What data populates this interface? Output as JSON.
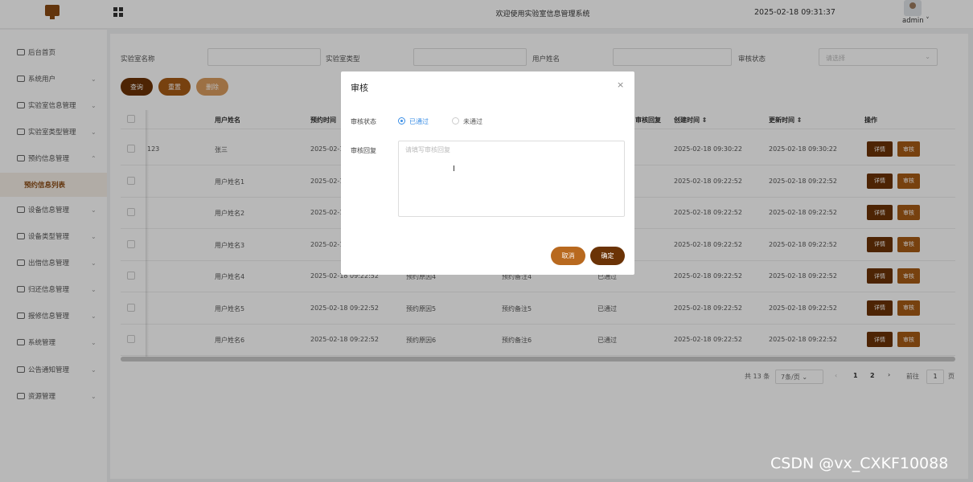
{
  "header": {
    "title": "欢迎使用实验室信息管理系统",
    "clock": "2025-02-18 09:31:37",
    "user": "admin ˅"
  },
  "sidebar": {
    "items": [
      {
        "label": "后台首页",
        "arrow": "",
        "icon": "clock-icon"
      },
      {
        "label": "系统用户",
        "arrow": "⌄",
        "icon": "user-icon"
      },
      {
        "label": "实验室信息管理",
        "arrow": "⌄",
        "icon": "list-icon"
      },
      {
        "label": "实验室类型管理",
        "arrow": "⌄",
        "icon": "list-icon"
      },
      {
        "label": "预约信息管理",
        "arrow": "⌃",
        "icon": "list-icon"
      },
      {
        "label": "预约信息列表",
        "arrow": "",
        "icon": ""
      },
      {
        "label": "设备信息管理",
        "arrow": "⌄",
        "icon": "list-icon"
      },
      {
        "label": "设备类型管理",
        "arrow": "⌄",
        "icon": "list-icon"
      },
      {
        "label": "出借信息管理",
        "arrow": "⌄",
        "icon": "list-icon"
      },
      {
        "label": "归还信息管理",
        "arrow": "⌄",
        "icon": "list-icon"
      },
      {
        "label": "报修信息管理",
        "arrow": "⌄",
        "icon": "list-icon"
      },
      {
        "label": "系统管理",
        "arrow": "⌄",
        "icon": "folder-icon"
      },
      {
        "label": "公告通知管理",
        "arrow": "⌄",
        "icon": "bell-icon"
      },
      {
        "label": "资源管理",
        "arrow": "⌄",
        "icon": "gear-icon"
      }
    ]
  },
  "search": {
    "lab_name_label": "实验室名称",
    "lab_type_label": "实验室类型",
    "user_name_label": "用户姓名",
    "audit_status_label": "审核状态",
    "audit_status_placeholder": "请选择",
    "query": "查询",
    "reset": "重置",
    "delete": "删除"
  },
  "table": {
    "headers": [
      "用户姓名",
      "预约时间",
      "审核回复",
      "创建时间 ⇕",
      "更新时间 ⇕",
      "操作"
    ],
    "rows": [
      {
        "id": "123",
        "user": "张三",
        "time": "2025-02-1",
        "reason": "",
        "note": "",
        "status": "",
        "created": "2025-02-18 09:30:22",
        "updated": "2025-02-18 09:30:22"
      },
      {
        "id": "",
        "user": "用户姓名1",
        "time": "2025-02-1",
        "reason": "",
        "note": "",
        "status": "",
        "created": "2025-02-18 09:22:52",
        "updated": "2025-02-18 09:22:52"
      },
      {
        "id": "",
        "user": "用户姓名2",
        "time": "2025-02-1",
        "reason": "",
        "note": "",
        "status": "",
        "created": "2025-02-18 09:22:52",
        "updated": "2025-02-18 09:22:52"
      },
      {
        "id": "",
        "user": "用户姓名3",
        "time": "2025-02-1",
        "reason": "",
        "note": "",
        "status": "",
        "created": "2025-02-18 09:22:52",
        "updated": "2025-02-18 09:22:52"
      },
      {
        "id": "",
        "user": "用户姓名4",
        "time": "2025-02-18 09:22:52",
        "reason": "预约原因4",
        "note": "预约备注4",
        "status": "已通过",
        "created": "2025-02-18 09:22:52",
        "updated": "2025-02-18 09:22:52"
      },
      {
        "id": "",
        "user": "用户姓名5",
        "time": "2025-02-18 09:22:52",
        "reason": "预约原因5",
        "note": "预约备注5",
        "status": "已通过",
        "created": "2025-02-18 09:22:52",
        "updated": "2025-02-18 09:22:52"
      },
      {
        "id": "",
        "user": "用户姓名6",
        "time": "2025-02-18 09:22:52",
        "reason": "预约原因6",
        "note": "预约备注6",
        "status": "已通过",
        "created": "2025-02-18 09:22:52",
        "updated": "2025-02-18 09:22:52"
      }
    ],
    "detail_btn": "详情",
    "audit_btn": "审核"
  },
  "pager": {
    "total": "共 13 条",
    "size": "7条/页",
    "pages": [
      "1",
      "2"
    ],
    "goto": "前往",
    "current": "1",
    "page_unit": "页"
  },
  "modal": {
    "title": "审核",
    "close": "×",
    "status_label": "审核状态",
    "option_pass": "已通过",
    "option_fail": "未通过",
    "reply_label": "审核回复",
    "reply_placeholder": "请填写审核回复",
    "reply_value": "",
    "cancel": "取消",
    "confirm": "确定"
  },
  "watermark": "CSDN @vx_CXKF10088"
}
